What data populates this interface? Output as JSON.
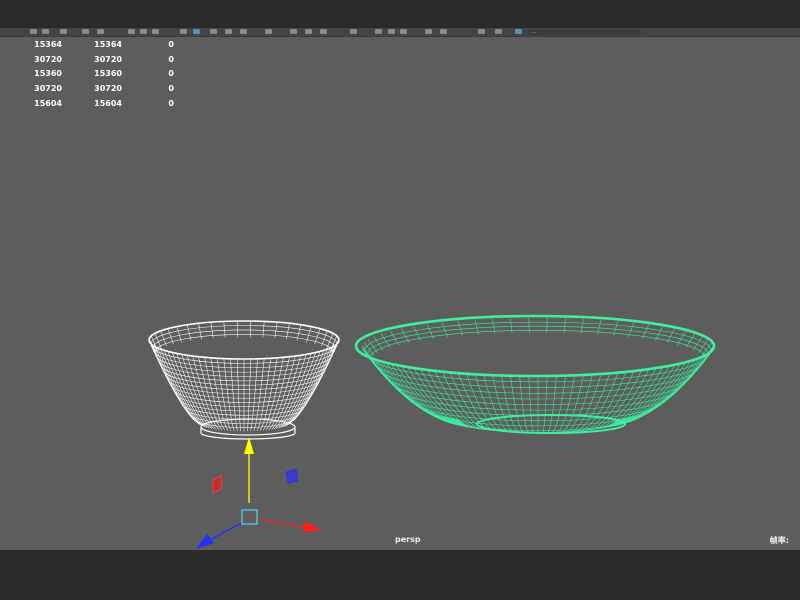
{
  "toolbar": {
    "field_text": "..."
  },
  "poly_count": {
    "rows": [
      [
        "15364",
        "15364",
        "0"
      ],
      [
        "30720",
        "30720",
        "0"
      ],
      [
        "15360",
        "15360",
        "0"
      ],
      [
        "30720",
        "30720",
        "0"
      ],
      [
        "15604",
        "15604",
        "0"
      ]
    ]
  },
  "viewport": {
    "camera": "persp",
    "corner_label": "帧率:",
    "objects": [
      "bowl",
      "plate"
    ],
    "selected_object": "plate",
    "selection_color": "#3df0a0",
    "wireframe_color": "#ffffff",
    "background_color": "#5d5d5d"
  },
  "manipulator": {
    "icons": [
      "move-y-axis-arrow",
      "move-x-axis-arrow",
      "move-z-axis-arrow",
      "move-center-box",
      "plane-handle-xz",
      "plane-handle-yz"
    ]
  }
}
